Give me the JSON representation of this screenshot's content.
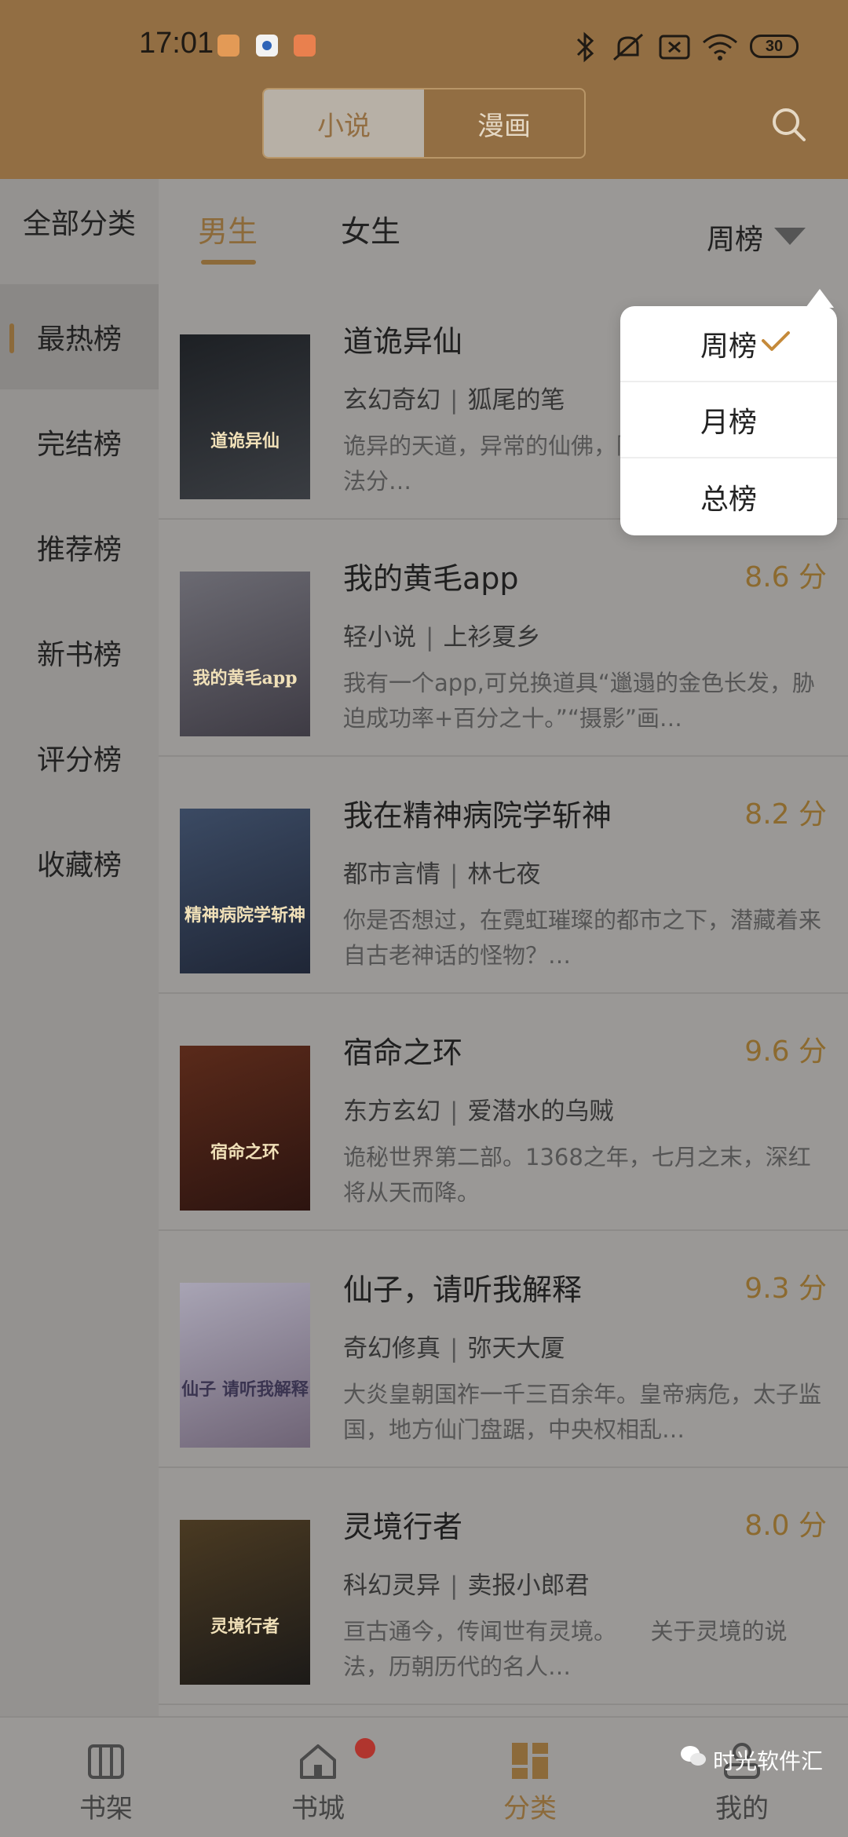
{
  "status_bar": {
    "time": "17:01",
    "battery": "30",
    "icons": [
      "bluetooth-icon",
      "mute-icon",
      "no-sim-icon",
      "wifi-icon",
      "battery-icon"
    ]
  },
  "header": {
    "tabs": [
      {
        "label": "小说",
        "active": true
      },
      {
        "label": "漫画",
        "active": false
      }
    ]
  },
  "sidebar": {
    "title": "全部分类",
    "items": [
      {
        "label": "最热榜",
        "active": true
      },
      {
        "label": "完结榜",
        "active": false
      },
      {
        "label": "推荐榜",
        "active": false
      },
      {
        "label": "新书榜",
        "active": false
      },
      {
        "label": "评分榜",
        "active": false
      },
      {
        "label": "收藏榜",
        "active": false
      }
    ]
  },
  "gender_tabs": [
    {
      "label": "男生",
      "active": true
    },
    {
      "label": "女生",
      "active": false
    }
  ],
  "rank_selector": {
    "label": "周榜"
  },
  "dropdown": {
    "options": [
      {
        "label": "周榜",
        "selected": true
      },
      {
        "label": "月榜",
        "selected": false
      },
      {
        "label": "总榜",
        "selected": false
      }
    ]
  },
  "books": [
    {
      "title": "道诡异仙",
      "score": "",
      "genre": "玄幻奇幻",
      "author": "狐尾的笔",
      "desc": "诡异的天道，异常的仙佛，陷入迷惘的李火旺无法分…",
      "cover_text": "道诡异仙",
      "cover_colors": [
        "#1d2024",
        "#3a3d42"
      ]
    },
    {
      "title": "我的黄毛app",
      "score": "8.6 分",
      "genre": "轻小说",
      "author": "上衫夏乡",
      "desc": "我有一个app,可兑换道具“邋遢的金色长发，胁迫成功率+百分之十。”“摄影”画…",
      "cover_text": "我的黄毛app",
      "cover_colors": [
        "#6b6a72",
        "#3e3b44"
      ]
    },
    {
      "title": "我在精神病院学斩神",
      "score": "8.2 分",
      "genre": "都市言情",
      "author": "林七夜",
      "desc": "你是否想过，在霓虹璀璨的都市之下，潜藏着来自古老神话的怪物？…",
      "cover_text": "精神病院学斩神",
      "cover_colors": [
        "#3b4a63",
        "#1f2636"
      ]
    },
    {
      "title": "宿命之环",
      "score": "9.6 分",
      "genre": "东方玄幻",
      "author": "爱潜水的乌贼",
      "desc": "诡秘世界第二部。1368之年，七月之末，深红将从天而降。",
      "cover_text": "宿命之环",
      "cover_colors": [
        "#5a2a1a",
        "#2c1410"
      ]
    },
    {
      "title": "仙子，请听我解释",
      "score": "9.3 分",
      "genre": "奇幻修真",
      "author": "弥天大厦",
      "desc": "大炎皇朝国祚一千三百余年。皇帝病危，太子监国，地方仙门盘踞，中央权相乱…",
      "cover_text": "仙子 请听我解释",
      "cover_colors": [
        "#a8a4b4",
        "#6f6476"
      ]
    },
    {
      "title": "灵境行者",
      "score": "8.0 分",
      "genre": "科幻灵异",
      "author": "卖报小郎君",
      "desc": "亘古通今，传闻世有灵境。　　关于灵境的说法，历朝历代的名人…",
      "cover_text": "灵境行者",
      "cover_colors": [
        "#4a3a22",
        "#1c1a18"
      ]
    }
  ],
  "bottom_nav": [
    {
      "label": "书架",
      "icon": "bookshelf-icon",
      "active": false
    },
    {
      "label": "书城",
      "icon": "home-icon",
      "active": false
    },
    {
      "label": "分类",
      "icon": "category-icon",
      "active": true
    },
    {
      "label": "我的",
      "icon": "profile-icon",
      "active": false
    }
  ],
  "watermark": "时光软件汇"
}
